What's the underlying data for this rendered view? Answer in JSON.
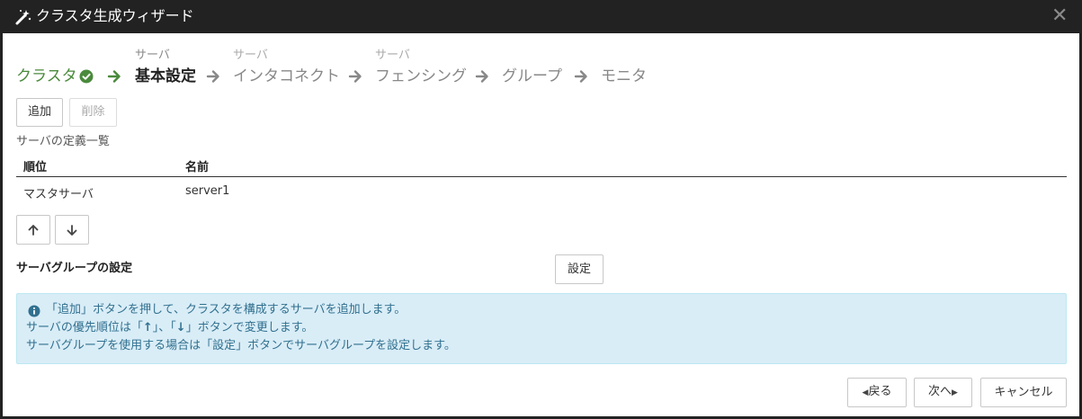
{
  "window": {
    "title": "クラスタ生成ウィザード"
  },
  "steps": [
    {
      "sub": "",
      "label": "クラスタ",
      "state": "done"
    },
    {
      "sub": "サーバ",
      "label": "基本設定",
      "state": "active"
    },
    {
      "sub": "サーバ",
      "label": "インタコネクト",
      "state": "pending"
    },
    {
      "sub": "サーバ",
      "label": "フェンシング",
      "state": "pending"
    },
    {
      "sub": "",
      "label": "グループ",
      "state": "pending"
    },
    {
      "sub": "",
      "label": "モニタ",
      "state": "pending"
    }
  ],
  "toolbar": {
    "add_label": "追加",
    "delete_label": "削除"
  },
  "server_list": {
    "label": "サーバの定義一覧",
    "columns": [
      "順位",
      "名前"
    ],
    "rows": [
      {
        "priority": "マスタサーバ",
        "name": "server1"
      }
    ]
  },
  "order_buttons": {
    "up": "↑",
    "down": "↓"
  },
  "server_group": {
    "label": "サーバグループの設定",
    "settings_label": "設定"
  },
  "info": {
    "line1": "「追加」ボタンを押して、クラスタを構成するサーバを追加します。",
    "line2_a": "サーバの優先順位は「",
    "line2_up": "↑",
    "line2_b": "」、「",
    "line2_down": "↓",
    "line2_c": "」ボタンで変更します。",
    "line3": "サーバグループを使用する場合は「設定」ボタンでサーバグループを設定します。"
  },
  "footer": {
    "back_label": "戻る",
    "next_label": "次へ",
    "cancel_label": "キャンセル"
  },
  "colors": {
    "titlebar": "#222222",
    "done_step": "#4a8a3c",
    "info_bg": "#d9edf7",
    "info_text": "#31708f"
  }
}
